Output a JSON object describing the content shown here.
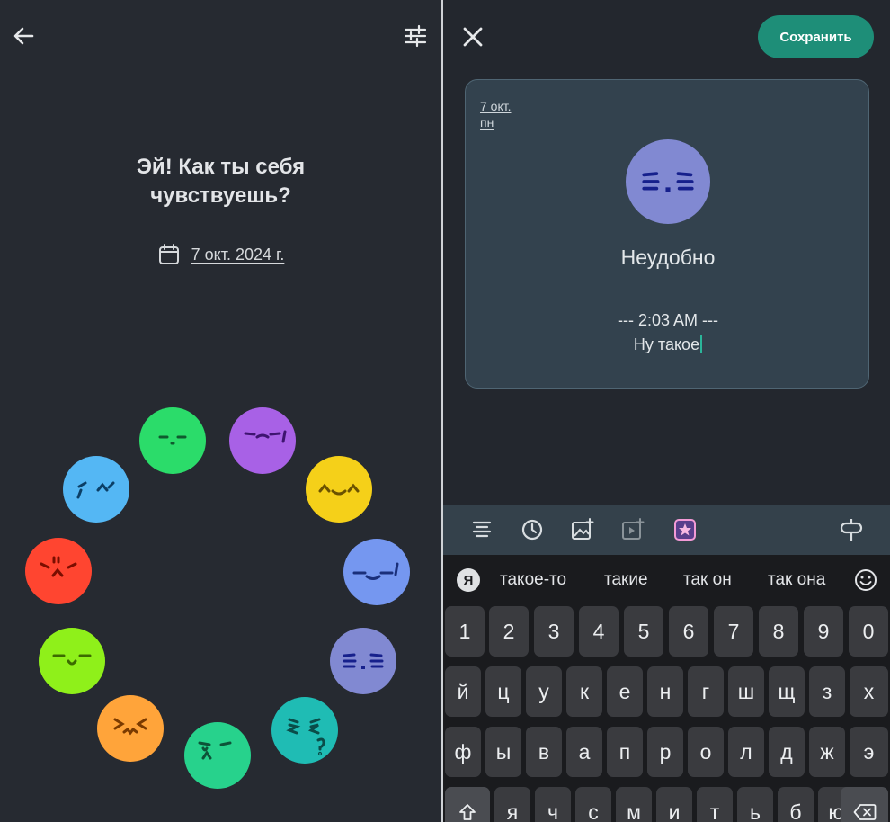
{
  "left": {
    "prompt_line1": "Эй! Как ты себя",
    "prompt_line2": "чувствуешь?",
    "date_text": "7 окт. 2024 г.",
    "icons": {
      "back": "arrow-left-icon",
      "filter": "sliders-icon",
      "calendar": "calendar-icon"
    },
    "moods": [
      {
        "name": "green-calm",
        "color": "#2bdc6a"
      },
      {
        "name": "purple-annoyed",
        "color": "#a861e6"
      },
      {
        "name": "yellow-happy",
        "color": "#f5d019"
      },
      {
        "name": "blue-tired",
        "color": "#7597f0"
      },
      {
        "name": "periwinkle-awkward",
        "color": "#8189d2"
      },
      {
        "name": "teal-confused",
        "color": "#1fbcb4"
      },
      {
        "name": "mint-skeptical",
        "color": "#27d28c"
      },
      {
        "name": "orange-excited",
        "color": "#ffa43a"
      },
      {
        "name": "lime-content",
        "color": "#8ff01a"
      },
      {
        "name": "red-angry",
        "color": "#ff4530"
      },
      {
        "name": "sky-sad",
        "color": "#54b7f4"
      }
    ]
  },
  "right": {
    "save_label": "Сохранить",
    "accent_color": "#1e8e78",
    "entry": {
      "date_line1": "7 окт.",
      "date_line2": "пн",
      "mood_label": "Неудобно",
      "time_label": "--- 2:03 AM ---",
      "note_prefix": "Ну ",
      "note_word": "такое"
    },
    "format_icons": [
      "list-icon",
      "clock-icon",
      "add-image-icon",
      "add-video-icon",
      "star-sticker-icon",
      "signpost-icon"
    ]
  },
  "keyboard": {
    "badge": "Я",
    "suggestions": [
      "такое-то",
      "такие",
      "так он",
      "так она"
    ],
    "rows": [
      [
        "1",
        "2",
        "3",
        "4",
        "5",
        "6",
        "7",
        "8",
        "9",
        "0"
      ],
      [
        "й",
        "ц",
        "у",
        "к",
        "е",
        "н",
        "г",
        "ш",
        "щ",
        "з",
        "х"
      ],
      [
        "ф",
        "ы",
        "в",
        "а",
        "п",
        "р",
        "о",
        "л",
        "д",
        "ж",
        "э"
      ],
      [
        "я",
        "ч",
        "с",
        "м",
        "и",
        "т",
        "ь",
        "б",
        "ю"
      ]
    ]
  }
}
